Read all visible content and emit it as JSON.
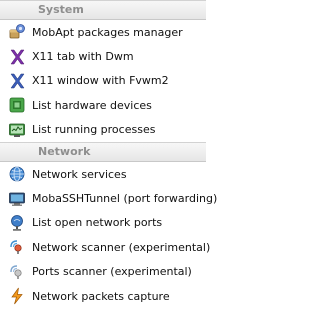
{
  "system": {
    "header": "System",
    "items": [
      {
        "label": "MobApt packages manager",
        "icon": "package-manager-icon"
      },
      {
        "label": "X11 tab with Dwm",
        "icon": "x11-dwm-icon"
      },
      {
        "label": "X11 window with Fvwm2",
        "icon": "x11-fvwm2-icon"
      },
      {
        "label": "List hardware devices",
        "icon": "hardware-devices-icon"
      },
      {
        "label": "List running processes",
        "icon": "running-processes-icon"
      }
    ]
  },
  "network": {
    "header": "Network",
    "items": [
      {
        "label": "Network services",
        "icon": "network-services-icon"
      },
      {
        "label": "MobaSSHTunnel (port forwarding)",
        "icon": "ssh-tunnel-icon"
      },
      {
        "label": "List open network ports",
        "icon": "network-ports-icon"
      },
      {
        "label": "Network scanner (experimental)",
        "icon": "network-scanner-icon"
      },
      {
        "label": "Ports scanner (experimental)",
        "icon": "ports-scanner-icon"
      },
      {
        "label": "Network packets capture",
        "icon": "packets-capture-icon"
      }
    ]
  }
}
